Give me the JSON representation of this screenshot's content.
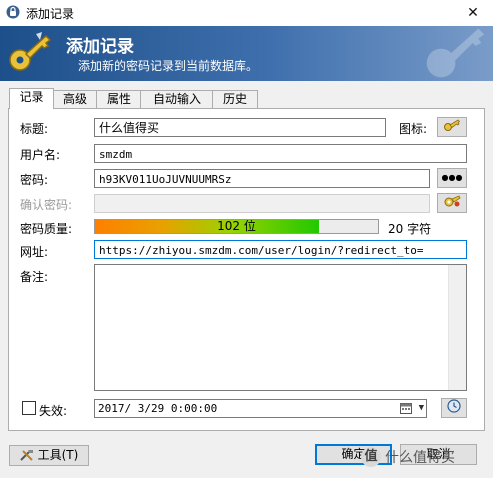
{
  "window": {
    "title": "添加记录",
    "close_glyph": "✕"
  },
  "banner": {
    "title": "添加记录",
    "subtitle": "添加新的密码记录到当前数据库。"
  },
  "tabs": [
    {
      "label": "记录",
      "active": true
    },
    {
      "label": "高级",
      "active": false
    },
    {
      "label": "属性",
      "active": false
    },
    {
      "label": "自动输入",
      "active": false
    },
    {
      "label": "历史",
      "active": false
    }
  ],
  "form": {
    "title_label": "标题:",
    "title_value": "什么值得买",
    "icon_label": "图标:",
    "username_label": "用户名:",
    "username_value": "smzdm",
    "password_label": "密码:",
    "password_value": "h93KV011UoJUVNUUMRSz",
    "password_toggle": "●●●",
    "confirm_label": "确认密码:",
    "confirm_value": "",
    "quality_label": "密码质量:",
    "quality_text": "102 位",
    "quality_fraction": 0.79,
    "char_count": "20 字符",
    "url_label": "网址:",
    "url_value": "https://zhiyou.smzdm.com/user/login/?redirect_to=",
    "notes_label": "备注:",
    "notes_value": "",
    "expires_label": "失效:",
    "expires_checked": false,
    "expires_value": "2017/ 3/29  0:00:00"
  },
  "footer": {
    "tools_label": "工具(T)",
    "ok_label": "确定",
    "cancel_label": "取消"
  },
  "watermark": {
    "badge": "值",
    "text": "什么值得买"
  },
  "colors": {
    "banner_start": "#1d4f8a",
    "banner_end": "#7a9cc9",
    "focus": "#0078d7"
  }
}
